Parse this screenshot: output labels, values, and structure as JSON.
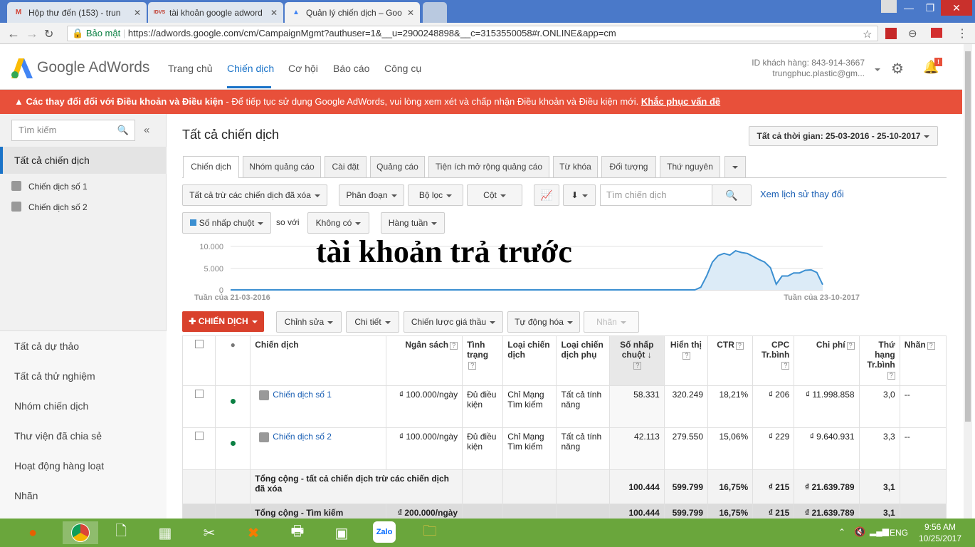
{
  "browser": {
    "tabs": [
      {
        "label": "Hộp thư đến (153) - trun",
        "icon": "gmail-icon",
        "glyph": "M"
      },
      {
        "label": "tài khoản google adword",
        "icon": "idvs-icon",
        "glyph": "IDVS"
      },
      {
        "label": "Quản lý chiến dịch – Goo",
        "icon": "adwords-icon",
        "glyph": "▲"
      }
    ],
    "secure_label": "Bảo mật",
    "url": "https://adwords.google.com/cm/CampaignMgmt?authuser=1&__u=2900248898&__c=3153550058#r.ONLINE&app=cm"
  },
  "header": {
    "logo_text": "Google AdWords",
    "nav": [
      "Trang chủ",
      "Chiến dịch",
      "Cơ hội",
      "Báo cáo",
      "Công cụ"
    ],
    "customer_id": "ID khách hàng: 843-914-3667",
    "account_email": "trungphuc.plastic@gm...",
    "notification_badge": "!"
  },
  "banner": {
    "bold": "Các thay đổi đối với Điều khoản và Điều kiện",
    "text": " - Để tiếp tục sử dụng Google AdWords, vui lòng xem xét và chấp nhận Điều khoản và Điều kiện mới. ",
    "link": "Khắc phục vấn đề"
  },
  "sidebar": {
    "search_placeholder": "Tìm kiếm",
    "collapse": "«",
    "all_campaigns": "Tất cả chiến dịch",
    "campaigns": [
      "Chiến dịch số 1",
      "Chiến dịch số 2"
    ],
    "links": [
      "Tất cả dự thảo",
      "Tất cả thử nghiệm",
      "Nhóm chiến dịch",
      "Thư viện đã chia sẻ",
      "Hoạt động hàng loạt",
      "Nhãn"
    ]
  },
  "main": {
    "title": "Tất cả chiến dịch",
    "date_range": "Tất cả thời gian: 25-03-2016 - 25-10-2017",
    "tabs": [
      "Chiến dịch",
      "Nhóm quảng cáo",
      "Cài đặt",
      "Quảng cáo",
      "Tiện ích mở rộng quảng cáo",
      "Từ khóa",
      "Đối tượng",
      "Thứ nguyên"
    ],
    "toolbar": {
      "filter": "Tất cả trừ các chiến dịch đã xóa",
      "segment": "Phân đoạn",
      "filter2": "Bộ lọc",
      "columns": "Cột",
      "search_placeholder": "Tìm chiến dịch",
      "history": "Xem lịch sử thay đổi"
    },
    "chart_controls": {
      "metric": "Số nhấp chuột",
      "compare": "so với",
      "compare_metric": "Không có",
      "period": "Hàng tuần"
    },
    "overlay_text": "tài khoản trả trước",
    "actions": {
      "new_campaign": "CHIẾN DỊCH",
      "edit": "Chỉnh sửa",
      "details": "Chi tiết",
      "bidding": "Chiến lược giá thầu",
      "automate": "Tự động hóa",
      "labels": "Nhãn"
    }
  },
  "chart_data": {
    "type": "area",
    "y_ticks": [
      "10.000",
      "5.000",
      "0"
    ],
    "ylim": [
      0,
      10000
    ],
    "x_start_label": "Tuần của 21-03-2016",
    "x_end_label": "Tuần của 23-10-2017",
    "series": [
      {
        "values": [
          0,
          0,
          0,
          0,
          0,
          0,
          0,
          0,
          0,
          0,
          0,
          0,
          0,
          0,
          0,
          0,
          0,
          0,
          0,
          0,
          0,
          0,
          0,
          0,
          0,
          0,
          0,
          0,
          0,
          0,
          0,
          0,
          0,
          0,
          0,
          0,
          0,
          0,
          0,
          0,
          0,
          0,
          0,
          0,
          0,
          0,
          0,
          0,
          0,
          0,
          0,
          0,
          0,
          0,
          0,
          0,
          0,
          0,
          0,
          0,
          0,
          0,
          0,
          0,
          0,
          0,
          0,
          0,
          0,
          0,
          0,
          0,
          0,
          0,
          0,
          0,
          0,
          0,
          0,
          0,
          0,
          600,
          3200,
          6400,
          7900,
          8400,
          8000,
          9000,
          8600,
          8400,
          7700,
          7000,
          6400,
          5100,
          1300,
          3200,
          3200,
          3900,
          3900,
          4500,
          4600,
          4000,
          1200
        ]
      }
    ]
  },
  "table": {
    "headers": [
      "Chiến dịch",
      "Ngân sách",
      "Tình trạng",
      "Loại chiến dịch",
      "Loại chiến dịch phụ",
      "Số nhấp chuột",
      "Hiển thị",
      "CTR",
      "CPC Tr.bình",
      "Chi phí",
      "Thứ hạng Tr.bình",
      "Nhãn"
    ],
    "rows": [
      {
        "name": "Chiến dịch số 1",
        "budget": "₫ 100.000/ngày",
        "status": "Đủ điều kiện",
        "type": "Chỉ Mạng Tìm kiếm",
        "subtype": "Tất cả tính năng",
        "clicks": "58.331",
        "impr": "320.249",
        "ctr": "18,21%",
        "cpc": "₫ 206",
        "cost": "₫ 11.998.858",
        "pos": "3,0",
        "labels": "--"
      },
      {
        "name": "Chiến dịch số 2",
        "budget": "₫ 100.000/ngày",
        "status": "Đủ điều kiện",
        "type": "Chỉ Mạng Tìm kiếm",
        "subtype": "Tất cả tính năng",
        "clicks": "42.113",
        "impr": "279.550",
        "ctr": "15,06%",
        "cpc": "₫ 229",
        "cost": "₫ 9.640.931",
        "pos": "3,3",
        "labels": "--"
      }
    ],
    "total": {
      "label": "Tổng cộng - tất cả chiến dịch trừ các chiến dịch đã xóa",
      "clicks": "100.444",
      "impr": "599.799",
      "ctr": "16,75%",
      "cpc": "₫ 215",
      "cost": "₫ 21.639.789",
      "pos": "3,1"
    },
    "total2": {
      "label": "Tổng cộng - Tìm kiếm",
      "budget": "₫ 200.000/ngày",
      "clicks": "100.444",
      "impr": "599.799",
      "ctr": "16,75%",
      "cpc": "₫ 215",
      "cost": "₫ 21.639.789",
      "pos": "3,1"
    }
  },
  "taskbar": {
    "time": "9:56 AM",
    "date": "10/25/2017",
    "lang": "ENG"
  },
  "colors": {
    "accent": "#1a73c8",
    "banner": "#e8503a",
    "new_button": "#d9412c",
    "chart_line": "#3b8fd1",
    "chart_fill": "#dcebf7"
  }
}
